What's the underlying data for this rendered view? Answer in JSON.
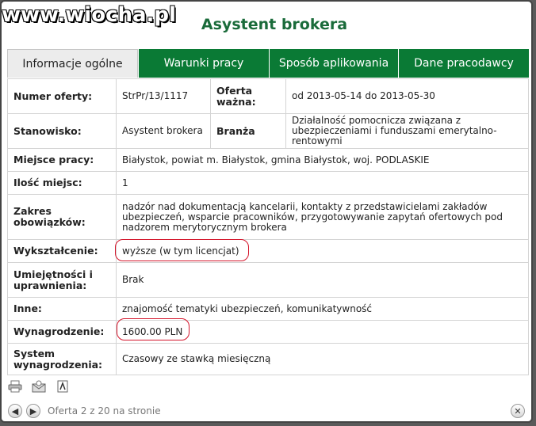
{
  "watermark": "www.wiocha.pl",
  "title": "Asystent brokera",
  "tabs": [
    {
      "label": "Informacje ogólne",
      "active": true
    },
    {
      "label": "Warunki pracy",
      "active": false
    },
    {
      "label": "Sposób aplikowania",
      "active": false
    },
    {
      "label": "Dane pracodawcy",
      "active": false
    }
  ],
  "rows": {
    "offer_no_label": "Numer oferty:",
    "offer_no_value": "StrPr/13/1117",
    "valid_label": "Oferta ważna:",
    "valid_value": "od 2013-05-14 do 2013-05-30",
    "position_label": "Stanowisko:",
    "position_value": "Asystent brokera",
    "industry_label": "Branża",
    "industry_value": "Działalność pomocnicza związana z ubezpieczeniami i funduszami emerytalno-rentowymi",
    "place_label": "Miejsce pracy:",
    "place_value": "Białystok, powiat m. Białystok, gmina Białystok, woj. PODLASKIE",
    "count_label": "Ilość miejsc:",
    "count_value": "1",
    "duties_label": "Zakres obowiązków:",
    "duties_value": "nadzór nad dokumentacją kancelarii, kontakty z przedstawicielami zakładów ubezpieczeń, wsparcie pracowników, przygotowywanie zapytań ofertowych pod nadzorem merytorycznym brokera",
    "education_label": "Wykształcenie:",
    "education_value": "wyższe (w tym licencjat)",
    "skills_label": "Umiejętności i uprawnienia:",
    "skills_value": "Brak",
    "other_label": "Inne:",
    "other_value": "znajomość tematyki ubezpieczeń, komunikatywność",
    "salary_label": "Wynagrodzenie:",
    "salary_value": "1600.00 PLN",
    "pay_system_label": "System wynagrodzenia:",
    "pay_system_value": "Czasowy ze stawką miesięczną"
  },
  "actions": {
    "print_icon": "printer-icon",
    "email_icon": "email-icon",
    "pdf_icon": "pdf-icon"
  },
  "footer": {
    "prev_icon": "arrow-left-icon",
    "next_icon": "arrow-right-icon",
    "page_info": "Oferta 2 z 20 na stronie",
    "close_icon": "close-icon"
  },
  "colors": {
    "tab_green": "#0a7a35",
    "title_green": "#1a6b3a",
    "highlight_red": "#d4142a"
  }
}
